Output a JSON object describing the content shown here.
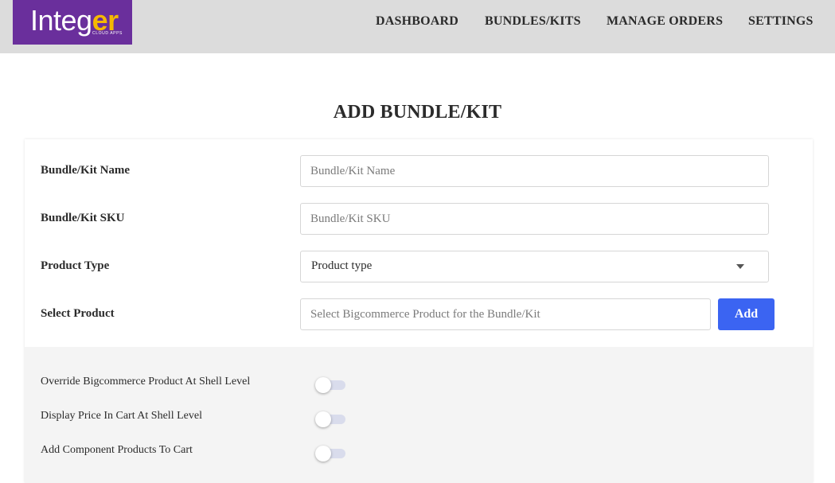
{
  "header": {
    "logo_text": "Integ",
    "logo_accent": "er",
    "logo_sub": "CLOUD APPS",
    "nav": [
      "DASHBOARD",
      "BUNDLES/KITS",
      "MANAGE ORDERS",
      "SETTINGS"
    ]
  },
  "page_title": "ADD BUNDLE/KIT",
  "form": {
    "name_label": "Bundle/Kit Name",
    "name_placeholder": "Bundle/Kit Name",
    "sku_label": "Bundle/Kit SKU",
    "sku_placeholder": "Bundle/Kit SKU",
    "type_label": "Product Type",
    "type_value": "Product type",
    "select_label": "Select Product",
    "select_placeholder": "Select Bigcommerce Product for the Bundle/Kit",
    "add_button": "Add"
  },
  "toggles": [
    {
      "label": "Override Bigcommerce Product At Shell Level",
      "on": false
    },
    {
      "label": "Display Price In Cart At Shell Level",
      "on": false
    },
    {
      "label": "Add Component Products To Cart",
      "on": false
    }
  ],
  "colors": {
    "brand": "#6a2f9c",
    "brand_accent": "#f5b800",
    "primary_button": "#3b64f2",
    "header_bg": "#dcdcdc"
  }
}
